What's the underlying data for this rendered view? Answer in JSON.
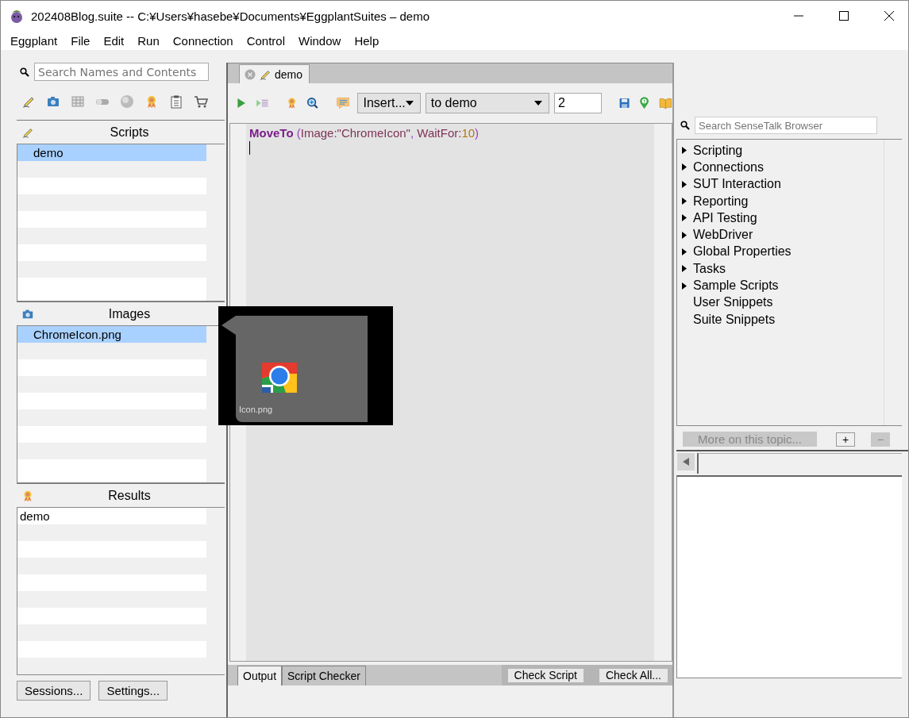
{
  "window": {
    "title": "202408Blog.suite -- C:¥Users¥hasebe¥Documents¥EggplantSuites – demo"
  },
  "menu": [
    "Eggplant",
    "File",
    "Edit",
    "Run",
    "Connection",
    "Control",
    "Window",
    "Help"
  ],
  "suite_search": {
    "placeholder": "Search Names and Contents"
  },
  "scripts": {
    "title": "Scripts",
    "items": [
      {
        "label": "demo",
        "selected": true
      }
    ]
  },
  "images": {
    "title": "Images",
    "items": [
      {
        "label": "ChromeIcon.png",
        "selected": true
      }
    ]
  },
  "results": {
    "title": "Results",
    "items": [
      {
        "label": "demo",
        "selected": false
      }
    ]
  },
  "bottom_buttons": [
    "Sessions...",
    "Settings..."
  ],
  "editor_tabs": [
    {
      "label": "demo",
      "selected": true
    }
  ],
  "insert_menu": {
    "value": "Insert..."
  },
  "handler_menu": {
    "value": "to demo"
  },
  "step_field": {
    "value": "2"
  },
  "code_lines": [
    {
      "tokens": [
        {
          "kind": "command",
          "text": "MoveTo"
        },
        {
          "kind": "paren",
          "text": " ("
        },
        {
          "kind": "param",
          "text": "Image:"
        },
        {
          "kind": "string",
          "text": "\"ChromeIcon\""
        },
        {
          "kind": "paren",
          "text": ", "
        },
        {
          "kind": "param",
          "text": "WaitFor:"
        },
        {
          "kind": "number",
          "text": "10"
        },
        {
          "kind": "paren",
          "text": ")"
        }
      ]
    }
  ],
  "image_preview": {
    "caption": "Icon.png"
  },
  "output_tabs": [
    {
      "label": "Output",
      "selected": true
    },
    {
      "label": "Script Checker",
      "selected": false
    }
  ],
  "checker_buttons": [
    "Check Script",
    "Check All..."
  ],
  "browser_search": {
    "placeholder": "Search SenseTalk Browser"
  },
  "browser_tree": [
    {
      "label": "Scripting",
      "kind": "folder"
    },
    {
      "label": "Connections",
      "kind": "folder"
    },
    {
      "label": "SUT Interaction",
      "kind": "folder"
    },
    {
      "label": "Reporting",
      "kind": "folder"
    },
    {
      "label": "API Testing",
      "kind": "folder"
    },
    {
      "label": "WebDriver",
      "kind": "folder"
    },
    {
      "label": "Global Properties",
      "kind": "folder"
    },
    {
      "label": "Tasks",
      "kind": "folder"
    },
    {
      "label": "Sample Scripts",
      "kind": "folder"
    },
    {
      "label": "User Snippets",
      "kind": "leaf"
    },
    {
      "label": "Suite Snippets",
      "kind": "leaf"
    }
  ],
  "more_button": {
    "label": "More on this topic...",
    "disabled": true
  },
  "zoom_buttons": [
    {
      "label": "+",
      "disabled": false
    },
    {
      "label": "−",
      "disabled": true
    }
  ]
}
